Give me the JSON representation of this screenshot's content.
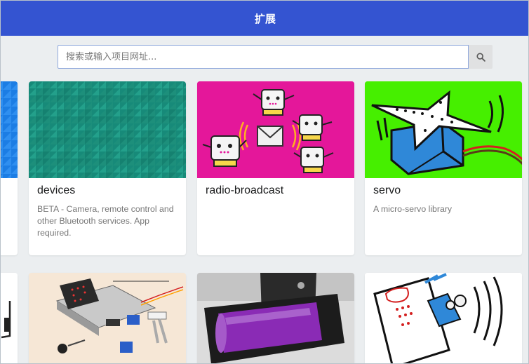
{
  "header": {
    "title": "扩展"
  },
  "search": {
    "placeholder": "搜索或输入项目网址..."
  },
  "icons": {
    "search": "search-icon"
  },
  "colors": {
    "header": "#3454d1",
    "devices_tile": "#1a8b7b",
    "radio_tile": "#e4179a",
    "servo_tile": "#46ef00"
  },
  "cards": [
    {
      "title": "devices",
      "description": "BETA - Camera, remote control and other Bluetooth services. App required."
    },
    {
      "title": "radio-broadcast",
      "description": ""
    },
    {
      "title": "servo",
      "description": "A micro-servo library"
    }
  ]
}
